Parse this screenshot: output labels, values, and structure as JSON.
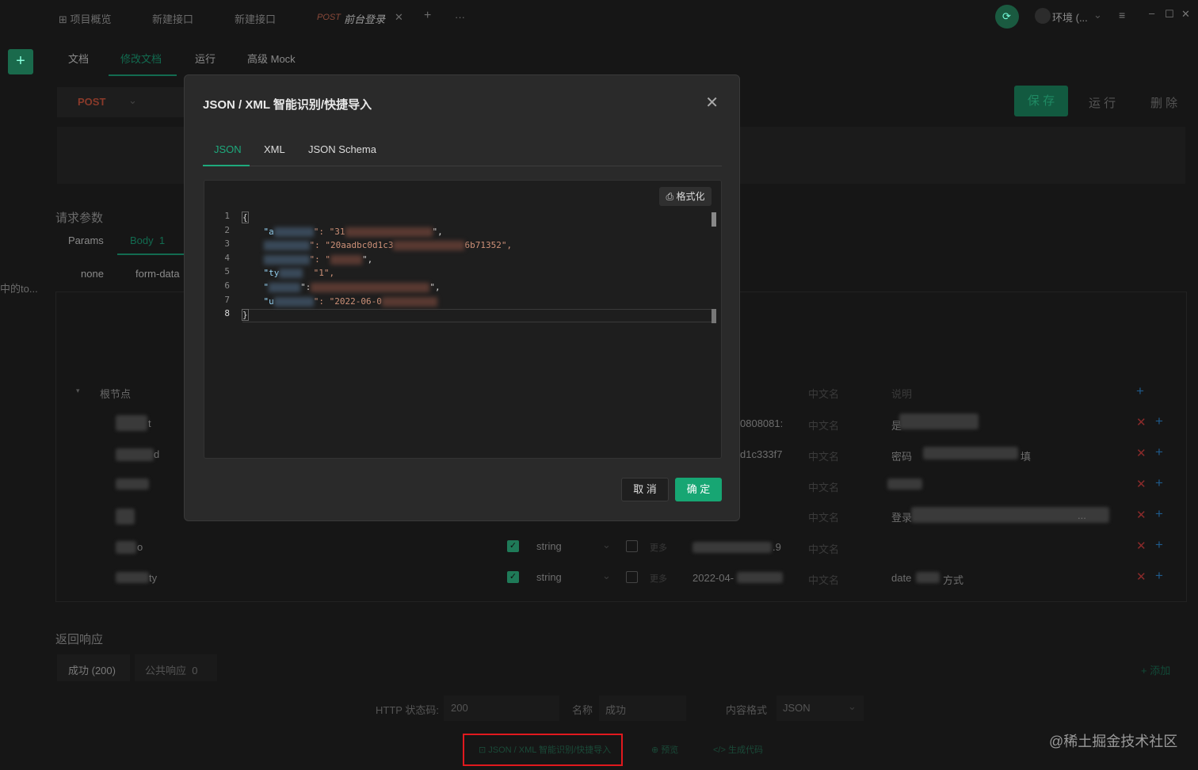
{
  "top_tabs": [
    "项目概览",
    "新建接口",
    "新建接口",
    "POST",
    "前台登录"
  ],
  "top_right": {
    "env_label": "环境 (...",
    "menu_icon": "hamburger-icon"
  },
  "sub_tabs": [
    "文档",
    "修改文档",
    "运行",
    "高级 Mock"
  ],
  "method": "POST",
  "actions": {
    "save": "保 存",
    "run": "运 行",
    "delete": "删 除"
  },
  "request_params": {
    "title": "请求参数",
    "tabs": [
      "Params",
      "Body  1"
    ],
    "body_types": [
      "none",
      "form-data"
    ],
    "root": "根节点",
    "headers": {
      "cn_name": "中文名",
      "desc": "说明"
    },
    "rows": [
      {
        "name_suffix": "t",
        "value": "0808081:",
        "cn": "中文名",
        "desc": "是"
      },
      {
        "name_suffix": "d",
        "value": "d1c333f7",
        "cn": "中文名",
        "desc": "密码",
        "desc_tail": "填"
      },
      {
        "name_suffix": "",
        "value": "",
        "cn": "中文名",
        "desc": ""
      },
      {
        "name_suffix": "",
        "value": "",
        "cn": "中文名",
        "desc": "登录",
        "desc_tail": "..."
      },
      {
        "name_suffix": "o",
        "type": "string",
        "more": "更多",
        "value": ".9",
        "cn": "中文名",
        "desc": ""
      },
      {
        "name_suffix": "ty",
        "type": "string",
        "more": "更多",
        "value": "2022-04-",
        "cn": "中文名",
        "desc": "date",
        "desc_tail": "方式"
      }
    ],
    "side_text": "中的to..."
  },
  "response": {
    "title": "返回响应",
    "tabs": [
      "成功 (200)",
      "公共响应  0"
    ],
    "add": "+ 添加",
    "http_status_label": "HTTP 状态码:",
    "http_status_value": "200",
    "name_label": "名称",
    "name_value": "成功",
    "content_label": "内容格式",
    "content_value": "JSON"
  },
  "bottom_links": [
    "JSON / XML 智能识别/快捷导入",
    "预览",
    "生成代码"
  ],
  "modal": {
    "title": "JSON / XML 智能识别/快捷导入",
    "tabs": [
      "JSON",
      "XML",
      "JSON Schema"
    ],
    "format_button": "格式化",
    "code_lines": [
      {
        "n": "1",
        "text": "{"
      },
      {
        "n": "2",
        "key": "\"a",
        "mid": "\": \"31",
        "tail": "\","
      },
      {
        "n": "3",
        "key": "",
        "mid": "\": \"20aadbc0d1c3",
        "tail": "6b71352\","
      },
      {
        "n": "4",
        "key": "",
        "mid": "\": \"",
        "tail": "\","
      },
      {
        "n": "5",
        "key": "\"ty",
        "mid": "  \"1\",",
        "tail": ""
      },
      {
        "n": "6",
        "key": "\"",
        "mid": "\":",
        "tail": "\","
      },
      {
        "n": "7",
        "key": "\"u",
        "mid": "\": \"2022-06-0",
        "tail": ""
      },
      {
        "n": "8",
        "text": "}"
      }
    ],
    "cancel": "取 消",
    "ok": "确 定"
  },
  "watermark": "@稀土掘金技术社区"
}
